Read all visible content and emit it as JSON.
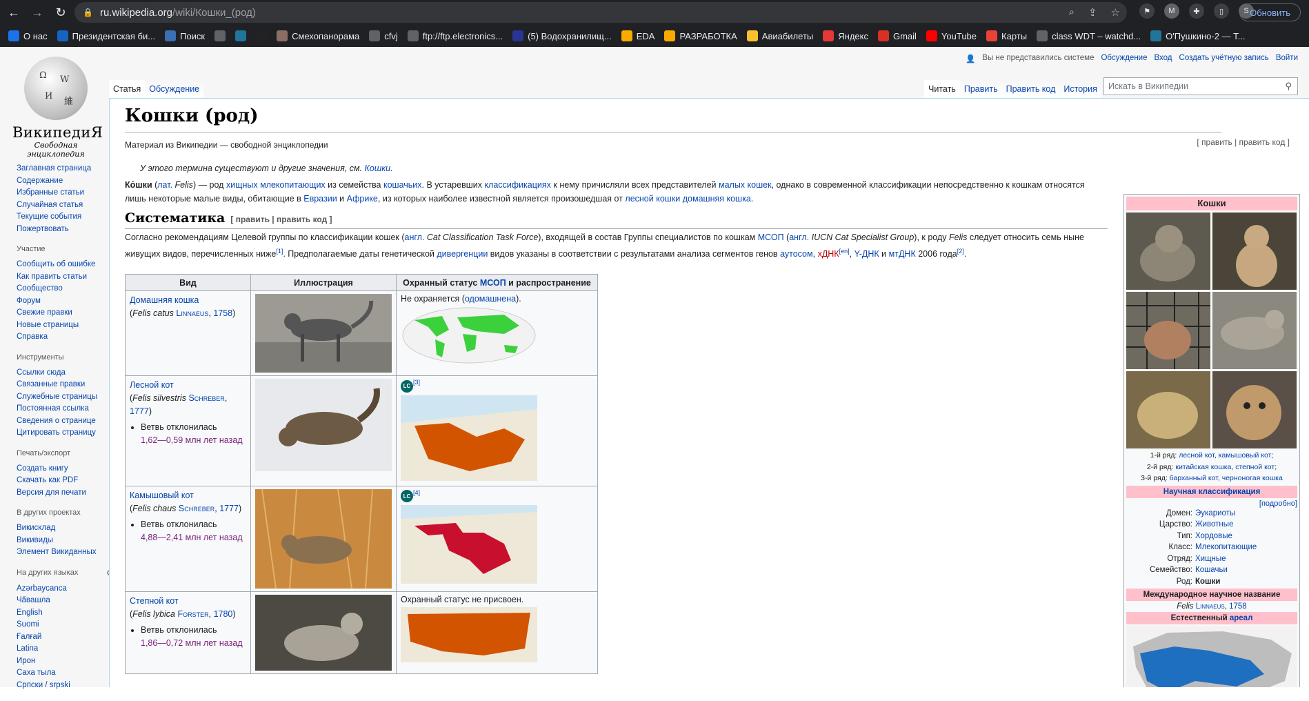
{
  "browser": {
    "url_host": "ru.wikipedia.org",
    "url_path": "/wiki/Кошки_(род)",
    "update_label": "Обновить",
    "profile_initial": "S",
    "ext_initial": "M",
    "bookmarks": [
      {
        "label": "О нас",
        "icon": "globe-blue",
        "color": "#1a73e8"
      },
      {
        "label": "Президентская би...",
        "icon": "flag",
        "color": "#1565c0"
      },
      {
        "label": "Поиск",
        "icon": "search",
        "color": "#3b6fb6"
      },
      {
        "label": "",
        "icon": "circle",
        "color": "#5f6368"
      },
      {
        "label": "",
        "icon": "wp",
        "color": "#21759b"
      },
      {
        "label": "",
        "icon": "moon",
        "color": "#222"
      },
      {
        "label": "Смехопанорама",
        "icon": "face",
        "color": "#8d6e63"
      },
      {
        "label": "cfvj",
        "icon": "circle",
        "color": "#5f6368"
      },
      {
        "label": "ftp://ftp.electronics...",
        "icon": "circle",
        "color": "#5f6368"
      },
      {
        "label": "(5) Водохранилищ...",
        "icon": "rp",
        "color": "#283593"
      },
      {
        "label": "EDA",
        "icon": "folder",
        "color": "#f9ab00"
      },
      {
        "label": "РАЗРАБОТКА",
        "icon": "folder",
        "color": "#f9ab00"
      },
      {
        "label": "Авиабилеты",
        "icon": "pen",
        "color": "#fbc02d"
      },
      {
        "label": "Яндекс",
        "icon": "ya",
        "color": "#e53935"
      },
      {
        "label": "Gmail",
        "icon": "mail",
        "color": "#d93025"
      },
      {
        "label": "YouTube",
        "icon": "yt",
        "color": "#ff0000"
      },
      {
        "label": "Карты",
        "icon": "pin",
        "color": "#ea4335"
      },
      {
        "label": "class WDT – watchd...",
        "icon": "doc",
        "color": "#5f6368"
      },
      {
        "label": "О'Пушкино-2 — Т...",
        "icon": "wp",
        "color": "#21759b"
      }
    ]
  },
  "logo": {
    "title": "ВикипедиЯ",
    "subtitle": "Свободная энциклопедия"
  },
  "sidebar": {
    "main": [
      "Заглавная страница",
      "Содержание",
      "Избранные статьи",
      "Случайная статья",
      "Текущие события",
      "Пожертвовать"
    ],
    "participation": {
      "title": "Участие",
      "items": [
        "Сообщить об ошибке",
        "Как править статьи",
        "Сообщество",
        "Форум",
        "Свежие правки",
        "Новые страницы",
        "Справка"
      ]
    },
    "tools": {
      "title": "Инструменты",
      "items": [
        "Ссылки сюда",
        "Связанные правки",
        "Служебные страницы",
        "Постоянная ссылка",
        "Сведения о странице",
        "Цитировать страницу"
      ]
    },
    "print": {
      "title": "Печать/экспорт",
      "items": [
        "Создать книгу",
        "Скачать как PDF",
        "Версия для печати"
      ]
    },
    "projects": {
      "title": "В других проектах",
      "items": [
        "Викисклад",
        "Викивиды",
        "Элемент Викиданных"
      ]
    },
    "languages": {
      "title": "На других языках",
      "items": [
        "Azərbaycanca",
        "Чӑвашла",
        "English",
        "Suomi",
        "Ғалғай",
        "Latina",
        "Ирон",
        "Саха тыла",
        "Српски / srpski"
      ]
    }
  },
  "personal": {
    "notlogged": "Вы не представились системе",
    "talk": "Обсуждение",
    "login": "Вход",
    "create": "Создать учётную запись",
    "enter": "Войти"
  },
  "tabs": {
    "article": "Статья",
    "discussion": "Обсуждение",
    "read": "Читать",
    "edit": "Править",
    "edit_code": "Править код",
    "history": "История"
  },
  "search": {
    "placeholder": "Искать в Википедии"
  },
  "article": {
    "title": "Кошки (род)",
    "from": "Материал из Википедии — свободной энциклопедии",
    "edit_links": "[ править | править код ]",
    "hatnote_prefix": "У этого термина существуют и другие значения, см. ",
    "hatnote_link": "Кошки",
    "intro": {
      "t1": "Ко́шки",
      "t2": " (",
      "t3": "лат.",
      "t4": " Felis",
      "t5": ") — род ",
      "l1": "хищных",
      "l2": "млекопитающих",
      "t6": " из семейства ",
      "l3": "кошачьих",
      "t7": ". В устаревших ",
      "l4": "классификациях",
      "t8": " к нему причисляли всех представителей ",
      "l5": "малых кошек",
      "t9": ", однако в современной классификации непосредственно к кошкам относятся лишь некоторые малые виды, обитающие в ",
      "l6": "Евразии",
      "t10": " и ",
      "l7": "Африке",
      "t11": ", из которых наиболее известной является произошедшая от ",
      "l8": "лесной кошки",
      "l9": "домашняя кошка",
      "t12": "."
    },
    "section_title": "Систематика",
    "section_edit": "[ править | править код ]",
    "para2": {
      "t1": "Согласно рекомендациям Целевой группы по классификации кошек (",
      "l1": "англ.",
      "t2": " Cat Classification Task Force",
      "t3": "), входящей в состав Группы специалистов по кошкам ",
      "l2": "МСОП",
      "t4": " (",
      "l3": "англ.",
      "t5": " IUCN Cat Specialist Group",
      "t6": "), к роду ",
      "t7": "Felis",
      "t8": " следует относить семь ныне живущих видов, перечисленных ниже",
      "s1": "[1]",
      "t9": ". Предполагаемые даты генетической ",
      "l4": "дивергенции",
      "t10": " видов указаны в соответствии с результатами анализа сегментов генов ",
      "l5": "аутосом",
      "t11": ", ",
      "l6": "хДНК",
      "s2": "[en]",
      "t12": ", ",
      "l7": "Y-ДНК",
      "t13": " и ",
      "l8": "мтДНК",
      "t14": " 2006 года",
      "s3": "[2]",
      "t15": "."
    },
    "table": {
      "headers": {
        "species": "Вид",
        "illustration": "Иллюстрация",
        "status_pre": "Охранный статус ",
        "status_link": "МСОП",
        "status_post": " и распространение"
      },
      "rows": [
        {
          "name": "Домашняя кошка",
          "latin": "Felis catus",
          "author": "Linnaeus",
          "year": "1758",
          "branch_label": "",
          "branch_value": "",
          "status_text": "Не охраняется (",
          "status_link": "одомашнена",
          "status_end": ").",
          "badge": "",
          "ref": ""
        },
        {
          "name": "Лесной кот",
          "latin": "Felis silvestris",
          "author": "Schreber",
          "year": "1777",
          "branch_label": "Ветвь отклонилась",
          "branch_value": "1,62—0,59 млн лет назад",
          "status_text": "",
          "status_link": "",
          "status_end": "",
          "badge": "LC",
          "ref": "[3]"
        },
        {
          "name": "Камышовый кот",
          "latin": "Felis chaus",
          "author": "Schreber",
          "year": "1777",
          "branch_label": "Ветвь отклонилась",
          "branch_value": "4,88—2,41 млн лет назад",
          "status_text": "",
          "status_link": "",
          "status_end": "",
          "badge": "LC",
          "ref": "[4]"
        },
        {
          "name": "Степной кот",
          "latin": "Felis lybica",
          "author": "Forster",
          "year": "1780",
          "branch_label": "Ветвь отклонилась",
          "branch_value": "1,86—0,72 млн лет назад",
          "status_text": "Охранный статус не присвоен.",
          "status_link": "",
          "status_end": "",
          "badge": "",
          "ref": ""
        }
      ]
    }
  },
  "infobox": {
    "title": "Кошки",
    "caption": {
      "r1": "1-й ряд: ",
      "r1a": "лесной кот",
      "r1b": "камышовый кот",
      "r2": "2-й ряд: ",
      "r2a": "китайская кошка",
      "r2b": "степной кот",
      "r3": "3-й ряд: ",
      "r3a": "барханный кот",
      "r3b": "черноногая кошка"
    },
    "sci_class": "Научная классификация",
    "more": "[подробно]",
    "rows": [
      {
        "k": "Домен:",
        "v": "Эукариоты"
      },
      {
        "k": "Царство:",
        "v": "Животные"
      },
      {
        "k": "Тип:",
        "v": "Хордовые"
      },
      {
        "k": "Класс:",
        "v": "Млекопитающие"
      },
      {
        "k": "Отряд:",
        "v": "Хищные"
      },
      {
        "k": "Семейство:",
        "v": "Кошачьи"
      },
      {
        "k": "Род:",
        "v": "Кошки"
      }
    ],
    "intl_name": "Международное научное название",
    "latin": "Felis",
    "author": "Linnaeus",
    "year": "1758",
    "range_pre": "Естественный ",
    "range_link": "ареал"
  }
}
